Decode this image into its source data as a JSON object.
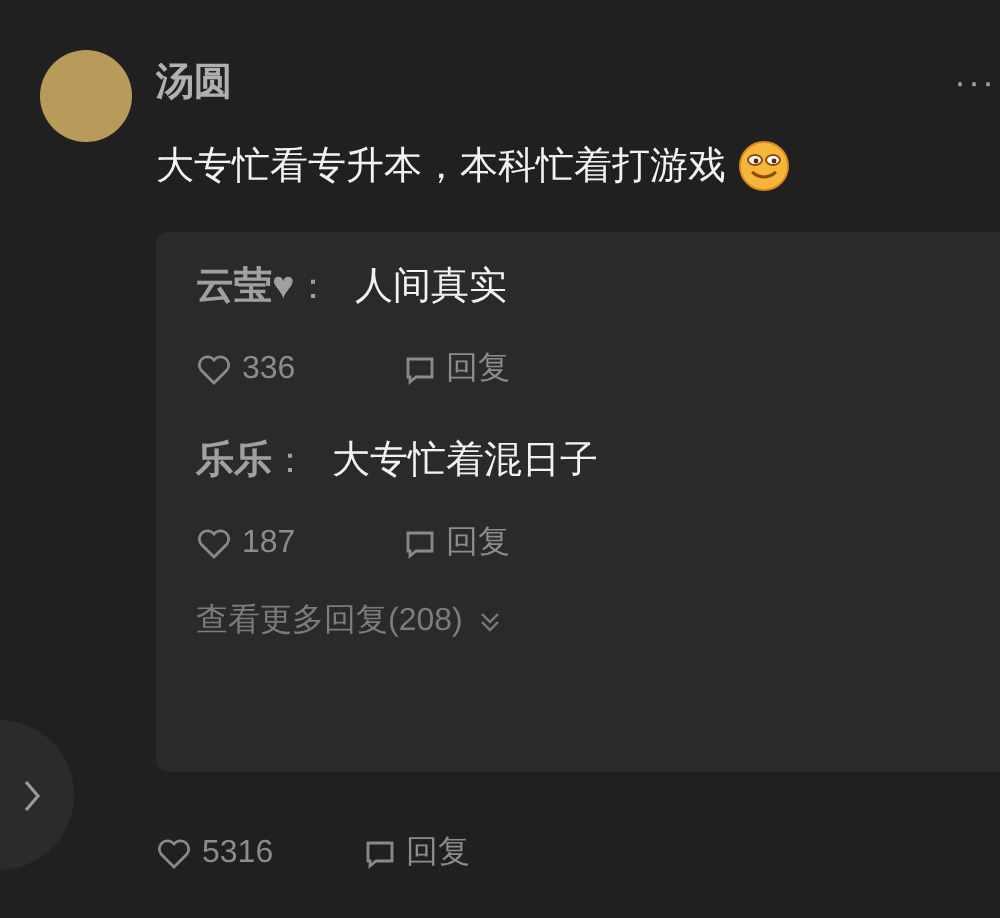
{
  "comment": {
    "author": "汤圆",
    "text": "大专忙看专升本，本科忙着打游戏",
    "more": "···",
    "replies": [
      {
        "author": "云莹♥",
        "separator": "：",
        "text": "人间真实",
        "likes": "336",
        "reply": "回复"
      },
      {
        "author": "乐乐",
        "separator": "：",
        "text": "大专忙着混日子",
        "likes": "187",
        "reply": "回复"
      }
    ],
    "view_more": "查看更多回复(208)",
    "likes": "5316",
    "reply": "回复"
  }
}
